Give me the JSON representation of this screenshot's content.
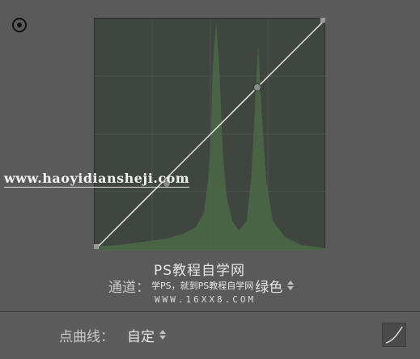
{
  "icons": {
    "target_adjust": "target-icon",
    "channel_stepper": "up-down-arrows-icon",
    "curve_mode": "curve-icon"
  },
  "watermark": {
    "url": "www.haoyidiansheji.com",
    "title": "PS教程自学网",
    "overlay": "学PS，就到PS教程自学网",
    "domain": "WWW.16XX8.COM"
  },
  "channel": {
    "label": "通道：",
    "value": "绿色"
  },
  "point_curve": {
    "label": "点曲线：",
    "value": "自定"
  },
  "colors": {
    "panel_bg": "#5a5a5a",
    "curve_bg": "#3f463f",
    "histogram": "#4b6a47",
    "curve_line": "#e8e8e8"
  }
}
